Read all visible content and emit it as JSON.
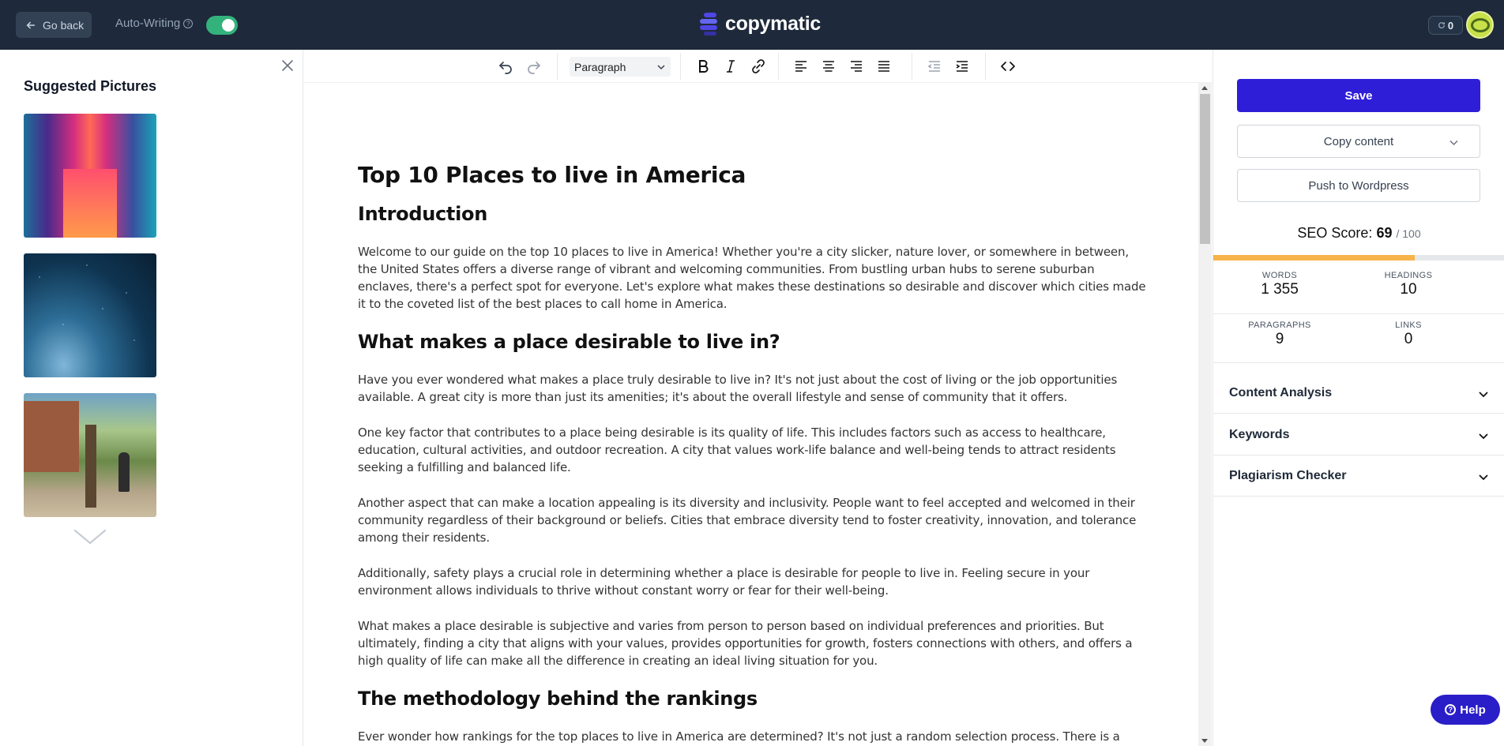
{
  "topbar": {
    "go_back_label": "Go back",
    "auto_writing_label": "Auto-Writing",
    "auto_writing_on": true,
    "brand": "copymatic",
    "credits": "0"
  },
  "left_panel": {
    "title": "Suggested Pictures",
    "pictures": [
      "abstract-neon-corridor",
      "starry-night-sky",
      "street-tree-with-sign"
    ]
  },
  "toolbar": {
    "format_value": "Paragraph"
  },
  "document": {
    "title": "Top 10 Places to live in America",
    "h_intro": "Introduction",
    "p_intro": "Welcome to our guide on the top 10 places to live in America! Whether you're a city slicker, nature lover, or somewhere in between, the United States offers a diverse range of vibrant and welcoming communities. From bustling urban hubs to serene suburban enclaves, there's a perfect spot for everyone. Let's explore what makes these destinations so desirable and discover which cities made it to the coveted list of the best places to call home in America.",
    "h_desirable": "What makes a place desirable to live in?",
    "p_des_1": "Have you ever wondered what makes a place truly desirable to live in? It's not just about the cost of living or the job opportunities available. A great city is more than just its amenities; it's about the overall lifestyle and sense of community that it offers.",
    "p_des_2": "One key factor that contributes to a place being desirable is its quality of life. This includes factors such as access to healthcare, education, cultural activities, and outdoor recreation. A city that values work-life balance and well-being tends to attract residents seeking a fulfilling and balanced life.",
    "p_des_3": "Another aspect that can make a location appealing is its diversity and inclusivity. People want to feel accepted and welcomed in their community regardless of their background or beliefs. Cities that embrace diversity tend to foster creativity, innovation, and tolerance among their residents.",
    "p_des_4": "Additionally, safety plays a crucial role in determining whether a place is desirable for people to live in. Feeling secure in your environment allows individuals to thrive without constant worry or fear for their well-being.",
    "p_des_5": "What makes a place desirable is subjective and varies from person to person based on individual preferences and priorities. But ultimately, finding a city that aligns with your values, provides opportunities for growth, fosters connections with others, and offers a high quality of life can make all the difference in creating an ideal living situation for you.",
    "h_method": "The methodology behind the rankings",
    "p_method": "Ever wonder how rankings for the top places to live in America are determined? It's not just a random selection process. There is a method"
  },
  "right_panel": {
    "save_label": "Save",
    "copy_label": "Copy content",
    "push_label": "Push to Wordpress",
    "seo_label": "SEO Score:",
    "seo_score": "69",
    "seo_max": "/ 100",
    "seo_fraction": 0.69,
    "seo_color": "#f6b44b",
    "stats": {
      "words_label": "WORDS",
      "words": "1 355",
      "headings_label": "HEADINGS",
      "headings": "10",
      "paragraphs_label": "PARAGRAPHS",
      "paragraphs": "9",
      "links_label": "LINKS",
      "links": "0"
    },
    "accordions": {
      "content_analysis": "Content Analysis",
      "keywords": "Keywords",
      "plagiarism": "Plagiarism Checker"
    }
  },
  "help_label": "Help",
  "colors": {
    "topbar": "#1e293b",
    "primary": "#2f1ed8",
    "toggle_on": "#34b27b"
  }
}
